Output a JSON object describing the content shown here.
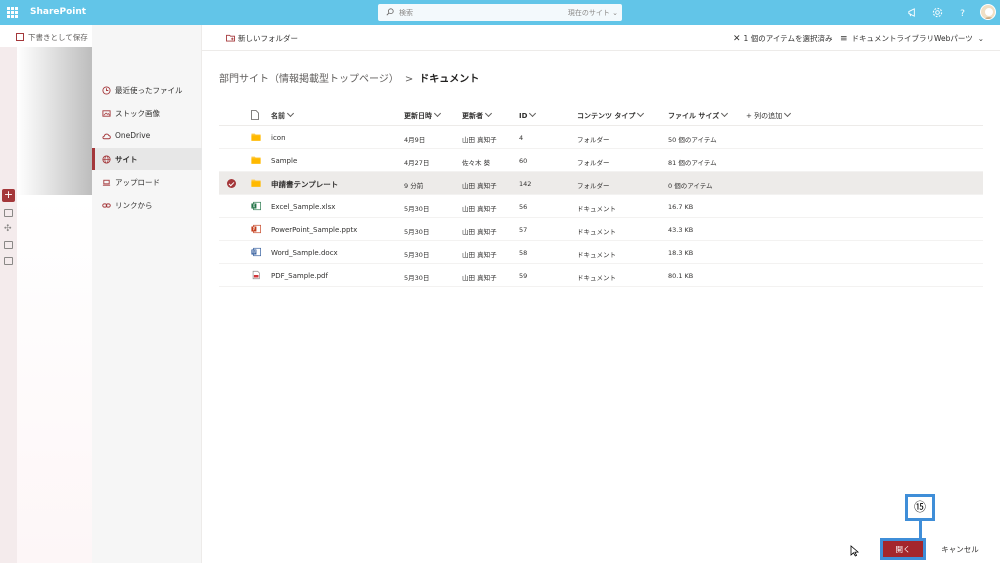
{
  "suite": {
    "app_name": "SharePoint",
    "search_placeholder": "検索",
    "search_scope": "現在のサイト",
    "colors": {
      "suite_bar": "#62c5e8",
      "accent": "#a4373a",
      "highlight": "#3f8ed8"
    }
  },
  "page": {
    "save_draft": "下書きとして保存"
  },
  "nav": {
    "items": [
      {
        "label": "最近使ったファイル",
        "icon": "clock-icon",
        "selected": false
      },
      {
        "label": "ストック画像",
        "icon": "image-icon",
        "selected": false
      },
      {
        "label": "OneDrive",
        "icon": "cloud-icon",
        "selected": false
      },
      {
        "label": "サイト",
        "icon": "globe-icon",
        "selected": true
      },
      {
        "label": "アップロード",
        "icon": "laptop-icon",
        "selected": false
      },
      {
        "label": "リンクから",
        "icon": "link-icon",
        "selected": false
      }
    ]
  },
  "commandbar": {
    "new_folder": "新しいフォルダー",
    "selected_count": "1 個のアイテムを選択済み",
    "webpart": "ドキュメントライブラリWebパーツ"
  },
  "breadcrumb": {
    "parent": "部門サイト（情報掲載型トップページ）",
    "separator": ">",
    "current": "ドキュメント"
  },
  "table": {
    "headers": {
      "name": "名前",
      "modified": "更新日時",
      "modified_by": "更新者",
      "id": "ID",
      "content_type": "コンテンツ タイプ",
      "file_size": "ファイル サイズ",
      "add_column": "列の追加"
    },
    "rows": [
      {
        "name": "icon",
        "modified": "4月9日",
        "modified_by": "山田 真知子",
        "id": "4",
        "content_type": "フォルダー",
        "file_size": "50 個のアイテム",
        "icon": "folder-icon",
        "selected": false
      },
      {
        "name": "Sample",
        "modified": "4月27日",
        "modified_by": "佐々木 葵",
        "id": "60",
        "content_type": "フォルダー",
        "file_size": "81 個のアイテム",
        "icon": "folder-icon",
        "selected": false
      },
      {
        "name": "申請書テンプレート",
        "modified": "9 分前",
        "modified_by": "山田 真知子",
        "id": "142",
        "content_type": "フォルダー",
        "file_size": "0 個のアイテム",
        "icon": "folder-icon",
        "selected": true
      },
      {
        "name": "Excel_Sample.xlsx",
        "modified": "5月30日",
        "modified_by": "山田 真知子",
        "id": "56",
        "content_type": "ドキュメント",
        "file_size": "16.7 KB",
        "icon": "excel-icon",
        "selected": false
      },
      {
        "name": "PowerPoint_Sample.pptx",
        "modified": "5月30日",
        "modified_by": "山田 真知子",
        "id": "57",
        "content_type": "ドキュメント",
        "file_size": "43.3 KB",
        "icon": "powerpoint-icon",
        "selected": false
      },
      {
        "name": "Word_Sample.docx",
        "modified": "5月30日",
        "modified_by": "山田 真知子",
        "id": "58",
        "content_type": "ドキュメント",
        "file_size": "18.3 KB",
        "icon": "word-icon",
        "selected": false
      },
      {
        "name": "PDF_Sample.pdf",
        "modified": "5月30日",
        "modified_by": "山田 真知子",
        "id": "59",
        "content_type": "ドキュメント",
        "file_size": "80.1 KB",
        "icon": "pdf-icon",
        "selected": false
      }
    ]
  },
  "footer": {
    "open": "開く",
    "cancel": "キャンセル",
    "step_marker": "⑮"
  }
}
